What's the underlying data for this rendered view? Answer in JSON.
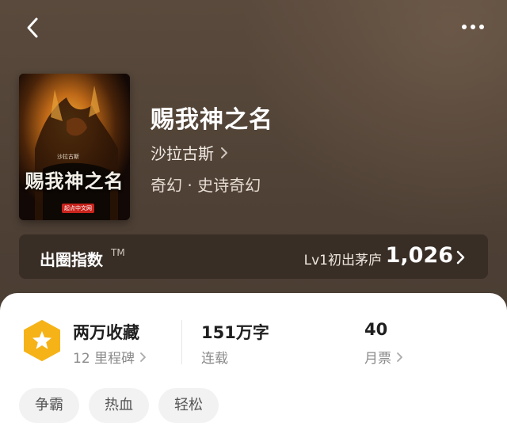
{
  "header": {
    "back_icon": "chevron-left-icon",
    "more_icon": "more-horizontal-icon"
  },
  "cover": {
    "title": "赐我神之名",
    "author": "沙拉古斯",
    "publisher": "起点中文网"
  },
  "book": {
    "title": "赐我神之名",
    "author": "沙拉古斯",
    "genre": "奇幻 · 史诗奇幻"
  },
  "index": {
    "label": "出圈指数",
    "tm": "TM",
    "level": "Lv1初出茅庐",
    "value": "1,026"
  },
  "stats": {
    "collection": {
      "title": "两万收藏",
      "sub": "12 里程碑"
    },
    "words": {
      "title": "151万字",
      "sub": "连载"
    },
    "monthly": {
      "title": "40",
      "sub": "月票"
    }
  },
  "tags": [
    "争霸",
    "热血",
    "轻松"
  ],
  "colors": {
    "badge": "#f6b318",
    "card_bg": "#ffffff",
    "hero_bg": "#5a4a3d"
  }
}
